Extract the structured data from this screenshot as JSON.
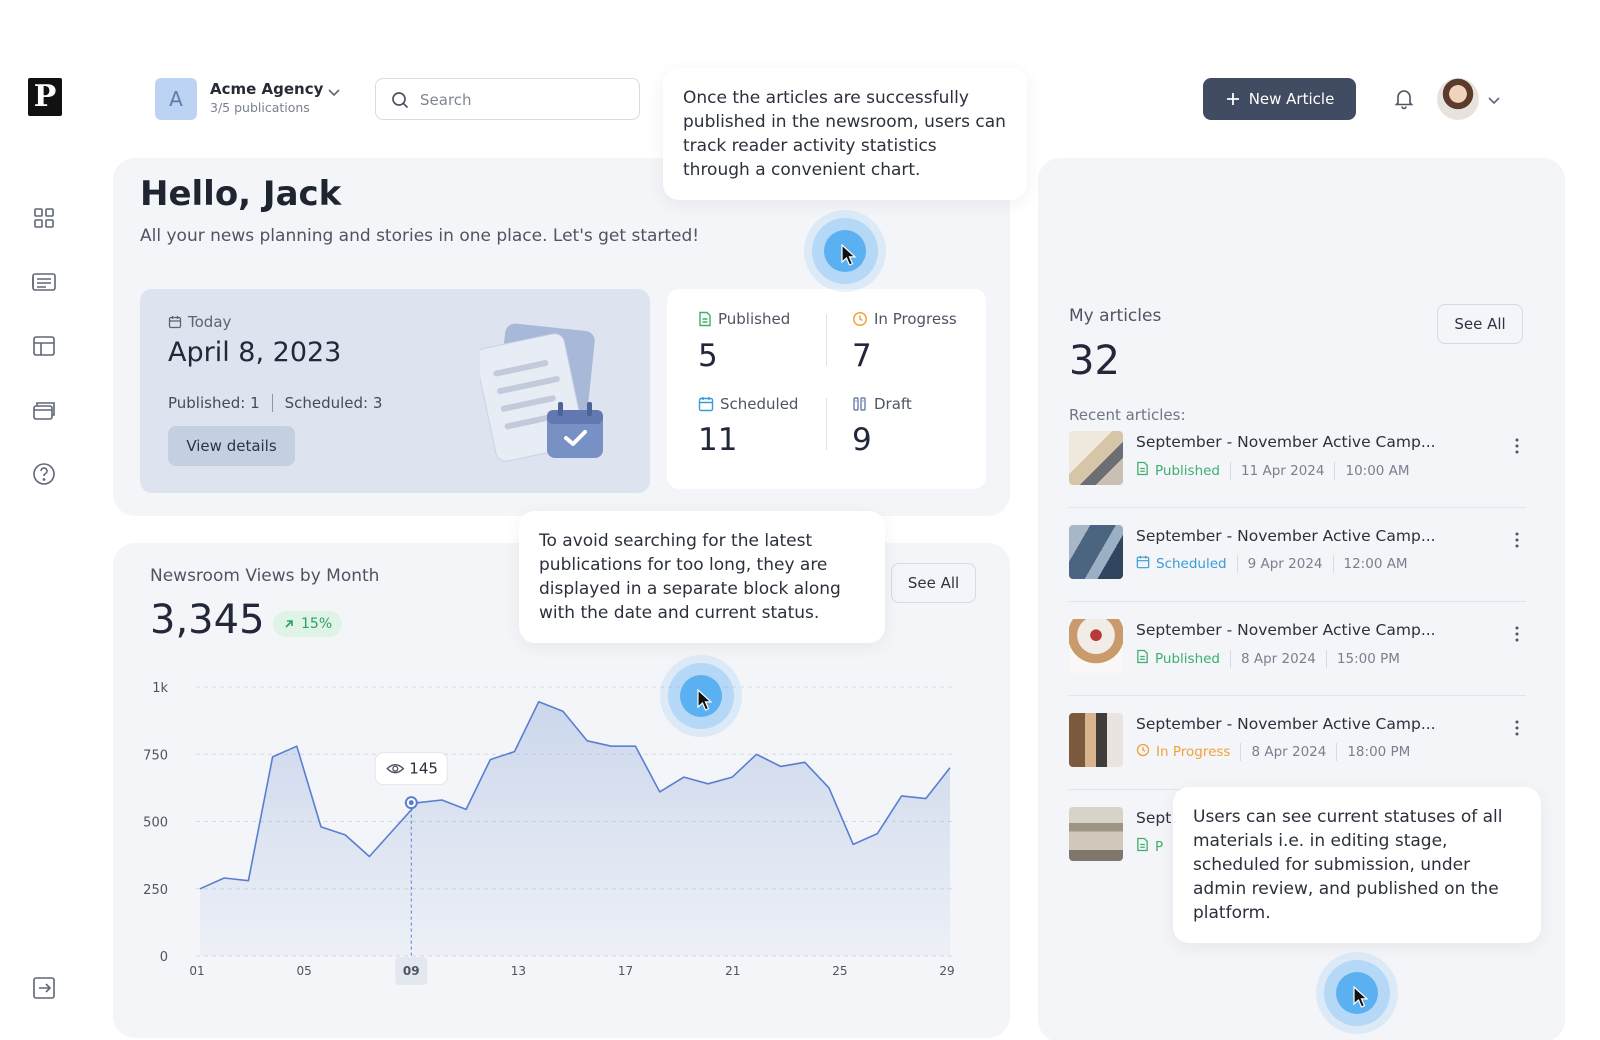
{
  "brand": {
    "logo_letter": "P"
  },
  "header": {
    "agency_initial": "A",
    "agency_name": "Acme Agency",
    "agency_sub": "3/5 publications",
    "search_placeholder": "Search",
    "new_article_label": "New Article"
  },
  "sidebar": {
    "items": [
      {
        "icon": "dashboard-grid-icon"
      },
      {
        "icon": "articles-list-icon"
      },
      {
        "icon": "layout-icon"
      },
      {
        "icon": "publications-stack-icon"
      },
      {
        "icon": "help-icon"
      }
    ],
    "logout_icon": "logout-icon"
  },
  "greeting": {
    "title": "Hello, Jack",
    "subtitle": "All your news planning and stories in one place. Let's get started!"
  },
  "today": {
    "label": "Today",
    "date": "April 8, 2023",
    "published_label": "Published:",
    "published_value": "1",
    "scheduled_label": "Scheduled:",
    "scheduled_value": "3",
    "button": "View details"
  },
  "stats": {
    "published": {
      "label": "Published",
      "value": "5",
      "color": "#3fae6f"
    },
    "in_progress": {
      "label": "In Progress",
      "value": "7",
      "color": "#f0a23a"
    },
    "scheduled": {
      "label": "Scheduled",
      "value": "11",
      "color": "#3b9bd6"
    },
    "draft": {
      "label": "Draft",
      "value": "9",
      "color": "#6b7ea8"
    }
  },
  "chart_panel": {
    "title": "Newsroom Views by Month",
    "total": "3,345",
    "change": "15%",
    "see_all": "See All",
    "tooltip_value": "145"
  },
  "chart_data": {
    "type": "area",
    "title": "Newsroom Views by Month",
    "x_ticks": [
      "01",
      "05",
      "09",
      "13",
      "17",
      "21",
      "25",
      "29"
    ],
    "y_ticks": [
      "0",
      "250",
      "500",
      "750",
      "1k"
    ],
    "ylim": [
      0,
      1000
    ],
    "xlim": [
      1,
      29
    ],
    "highlight_x": "09",
    "x": [
      1,
      2,
      3,
      4,
      5,
      6,
      7,
      8,
      9,
      10,
      11,
      12,
      13,
      14,
      15,
      16,
      17,
      18,
      19,
      20,
      21,
      22,
      23,
      24,
      25,
      26,
      27,
      28,
      29
    ],
    "values": [
      250,
      290,
      280,
      740,
      780,
      480,
      450,
      370,
      470,
      570,
      580,
      545,
      730,
      760,
      945,
      910,
      800,
      780,
      780,
      610,
      665,
      640,
      665,
      750,
      705,
      720,
      625,
      415,
      455,
      595,
      585,
      700
    ],
    "grid": true
  },
  "right_panel": {
    "title": "My articles",
    "count": "32",
    "see_all": "See All",
    "recent_label": "Recent articles:",
    "articles": [
      {
        "title": "September - November Active Camp...",
        "status": "Published",
        "status_color": "#3fae6f",
        "date": "11 Apr 2024",
        "time": "10:00 AM",
        "thumb": "laptop-desk"
      },
      {
        "title": "September - November Active Camp...",
        "status": "Scheduled",
        "status_color": "#3b9bd6",
        "date": "9 Apr 2024",
        "time": "12:00 AM",
        "thumb": "office-building"
      },
      {
        "title": "September - November Active Camp...",
        "status": "Published",
        "status_color": "#3fae6f",
        "date": "8 Apr 2024",
        "time": "15:00 PM",
        "thumb": "cupcake"
      },
      {
        "title": "September - November Active Camp...",
        "status": "In Progress",
        "status_color": "#f0a23a",
        "date": "8 Apr 2024",
        "time": "18:00 PM",
        "thumb": "man-at-computer"
      },
      {
        "title": "Sept",
        "status": "P",
        "status_color": "#3fae6f",
        "date": "",
        "time": "",
        "thumb": "classical-building"
      }
    ]
  },
  "tooltips": {
    "chart_tip": "Once the articles are successfully published in the newsroom, users can track reader activity statistics through a convenient chart.",
    "recent_tip": "To avoid searching for the latest publications for too long, they are displayed in a separate block along with the date and current status.",
    "status_tip": "Users can see current statuses of all materials i.e. in editing stage, scheduled for submission, under admin review, and published on the platform."
  }
}
